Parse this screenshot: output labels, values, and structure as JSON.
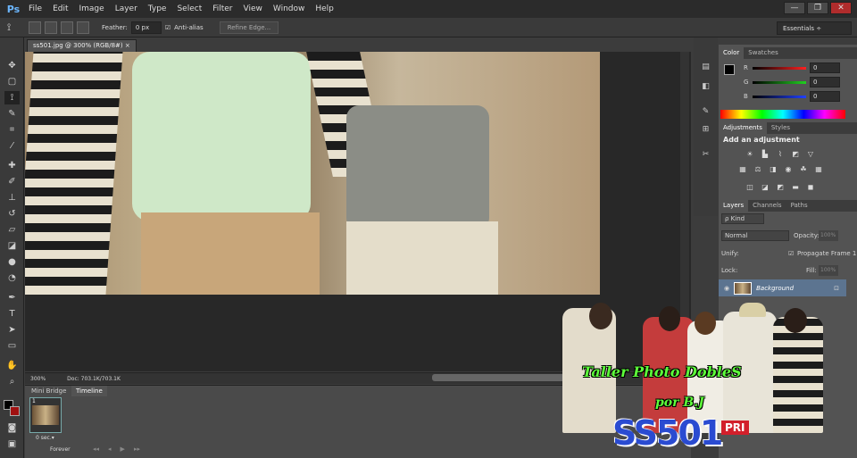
{
  "app": {
    "logo": "Ps"
  },
  "menu": [
    "File",
    "Edit",
    "Image",
    "Layer",
    "Type",
    "Select",
    "Filter",
    "View",
    "Window",
    "Help"
  ],
  "window_controls": {
    "minimize": "—",
    "restore": "❐",
    "close": "✕"
  },
  "options": {
    "feather_label": "Feather:",
    "feather_value": "0 px",
    "antialias_label": "Anti-alias",
    "refine_label": "Refine Edge..."
  },
  "workspace": "Essentials ÷",
  "document": {
    "tab": "ss501.jpg @ 300% (RGB/8#)",
    "tab_close": "×",
    "zoom": "300%",
    "doc_info": "Doc: 703.1K/703.1K"
  },
  "bottom": {
    "tabs": [
      "Mini Bridge",
      "Timeline"
    ],
    "frame_number": "1",
    "frame_delay": "0 sec.▾",
    "loop": "Forever"
  },
  "color_panel": {
    "tabs": [
      "Color",
      "Swatches"
    ],
    "channels": [
      {
        "label": "R",
        "value": "0",
        "color": "#ff2020"
      },
      {
        "label": "G",
        "value": "0",
        "color": "#20d020"
      },
      {
        "label": "B",
        "value": "0",
        "color": "#2040ff"
      }
    ]
  },
  "adjustments": {
    "tabs": [
      "Adjustments",
      "Styles"
    ],
    "heading": "Add an adjustment"
  },
  "layers": {
    "tabs": [
      "Layers",
      "Channels",
      "Paths"
    ],
    "filter": "ρ Kind",
    "blend": "Normal",
    "opacity_label": "Opacity:",
    "opacity_value": "100%",
    "unify": "Unify:",
    "propagate": "Propagate Frame 1",
    "lock": "Lock:",
    "fill_label": "Fill:",
    "fill_value": "100%",
    "layer_name": "Background"
  },
  "watermark": {
    "title": "Taller Photo DobleS",
    "by": "por B.J",
    "logo": "SS501",
    "tag": "PRI"
  },
  "icons": {
    "marquee": "▢",
    "lasso": "⟟",
    "move": "✥",
    "hand": "✋",
    "zoom": "⌕",
    "text": "T",
    "eye": "👁",
    "lock": "🔒"
  }
}
